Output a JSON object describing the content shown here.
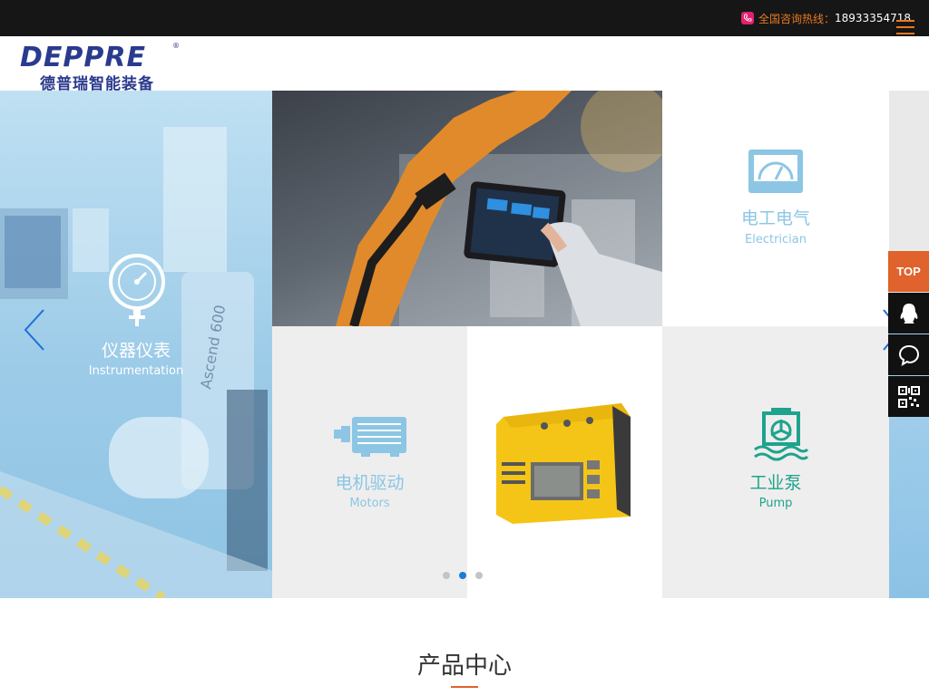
{
  "topbar": {
    "hotline_label": "全国咨询热线：",
    "hotline_number": "18933354718",
    "accent_color": "#e8791f"
  },
  "header": {
    "logo_en": "DEPPRE",
    "logo_reg": "®",
    "logo_cn": "德普瑞智能装备",
    "brand_color": "#2a3a8e"
  },
  "banner": {
    "categories": [
      {
        "zh": "仪器仪表",
        "en": "Instrumentation",
        "icon": "pressure-gauge-icon"
      },
      {
        "zh": "电工电气",
        "en": "Electrician",
        "icon": "meter-icon"
      },
      {
        "zh": "电机驱动",
        "en": "Motors",
        "icon": "motor-icon"
      },
      {
        "zh": "工业泵",
        "en": "Pump",
        "icon": "pump-icon"
      }
    ],
    "carousel": {
      "total": 3,
      "active_index": 1
    }
  },
  "side_tools": {
    "top_label": "TOP",
    "items": [
      "qq-icon",
      "chat-icon",
      "qrcode-icon"
    ]
  },
  "section": {
    "title": "产品中心"
  }
}
